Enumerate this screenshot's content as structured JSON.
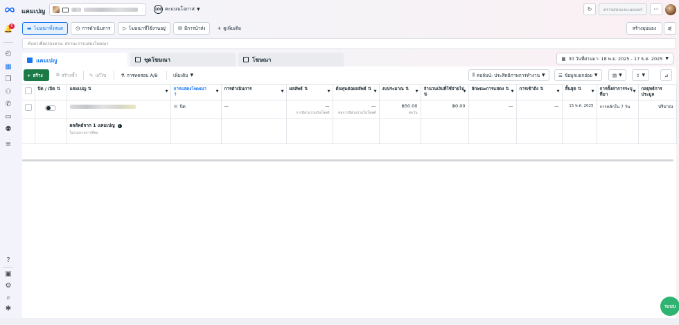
{
  "app": {
    "title": "แคมเปญ"
  },
  "header": {
    "opportunity_score": "100",
    "opportunity_label": "คะแนนโอกาส",
    "review_button": "ตรวจสอบและเผยแพร่",
    "more": "···"
  },
  "nav": {
    "notification_count": "6"
  },
  "view_tabs": [
    {
      "label": "โฆษณาทั้งหมด"
    },
    {
      "label": "การดำเนินการ"
    },
    {
      "label": "โฆษณาที่ใช้งานอยู่"
    },
    {
      "label": "มีการนำส่ง"
    },
    {
      "label": "ดูเพิ่มเติม"
    }
  ],
  "create_view": "สร้างมุมมอง",
  "search": {
    "placeholder": "ค้นหาเพื่อกรองตาม: สถานะการแสดงโฆษณา"
  },
  "level_tabs": [
    {
      "label": "แคมเปญ"
    },
    {
      "label": "ชุดโฆษณา"
    },
    {
      "label": "โฆษณา"
    }
  ],
  "date_range": "30 วันที่ผ่านมา: 18 พ.ย. 2025 - 17 ธ.ค. 2025",
  "toolbar": {
    "create": "สร้าง",
    "duplicate": "สร้างซ้ำ",
    "edit": "แก้ไข",
    "ab_test": "การทดสอบ A/B",
    "more": "เพิ่มเติม",
    "columns": "คอลัมน์: ประสิทธิภาพการทำงาน",
    "breakdown": "ข้อมูลแยกย่อย"
  },
  "table": {
    "headers": {
      "on_off": "ปิด / เปิด",
      "campaign": "แคมเปญ",
      "delivery": "การแสดงโฆษณา",
      "actions": "การดำเนินการ",
      "results": "ผลลัพธ์",
      "cost_per_result": "ต้นทุนต่อผลลัพธ์",
      "budget": "งบประมาณ",
      "amount_spent": "จำนวนเงินที่ใช้จ่ายไป",
      "impressions": "ลักษณะการแสดง",
      "reach": "การเข้าถึง",
      "ends": "สิ้นสุด",
      "attribution": "การตั้งค่าการระบุที่มา",
      "bid_strategy": "กลยุทธ์การประมูล"
    },
    "row": {
      "status": "ปิด",
      "actions": "—",
      "results": "—",
      "results_sub": "การมีส่วนร่วมกับโพสต์",
      "cost": "—",
      "cost_sub": "ต่อการมีส่วนร่วมในโพสต์",
      "budget": "฿50.00",
      "budget_sub": "ต่อวัน",
      "spent": "฿0.00",
      "impressions": "—",
      "reach": "—",
      "ends": "15 พ.ค. 2025",
      "attribution": "การคลิกใน 7 วัน",
      "bid": "ปริมาณ"
    },
    "summary": {
      "label": "ผลลัพธ์จาก 1 แคมเปญ",
      "sub": "ไม่รวมรายการที่ลบ"
    }
  },
  "help_fab": "ระบบ"
}
